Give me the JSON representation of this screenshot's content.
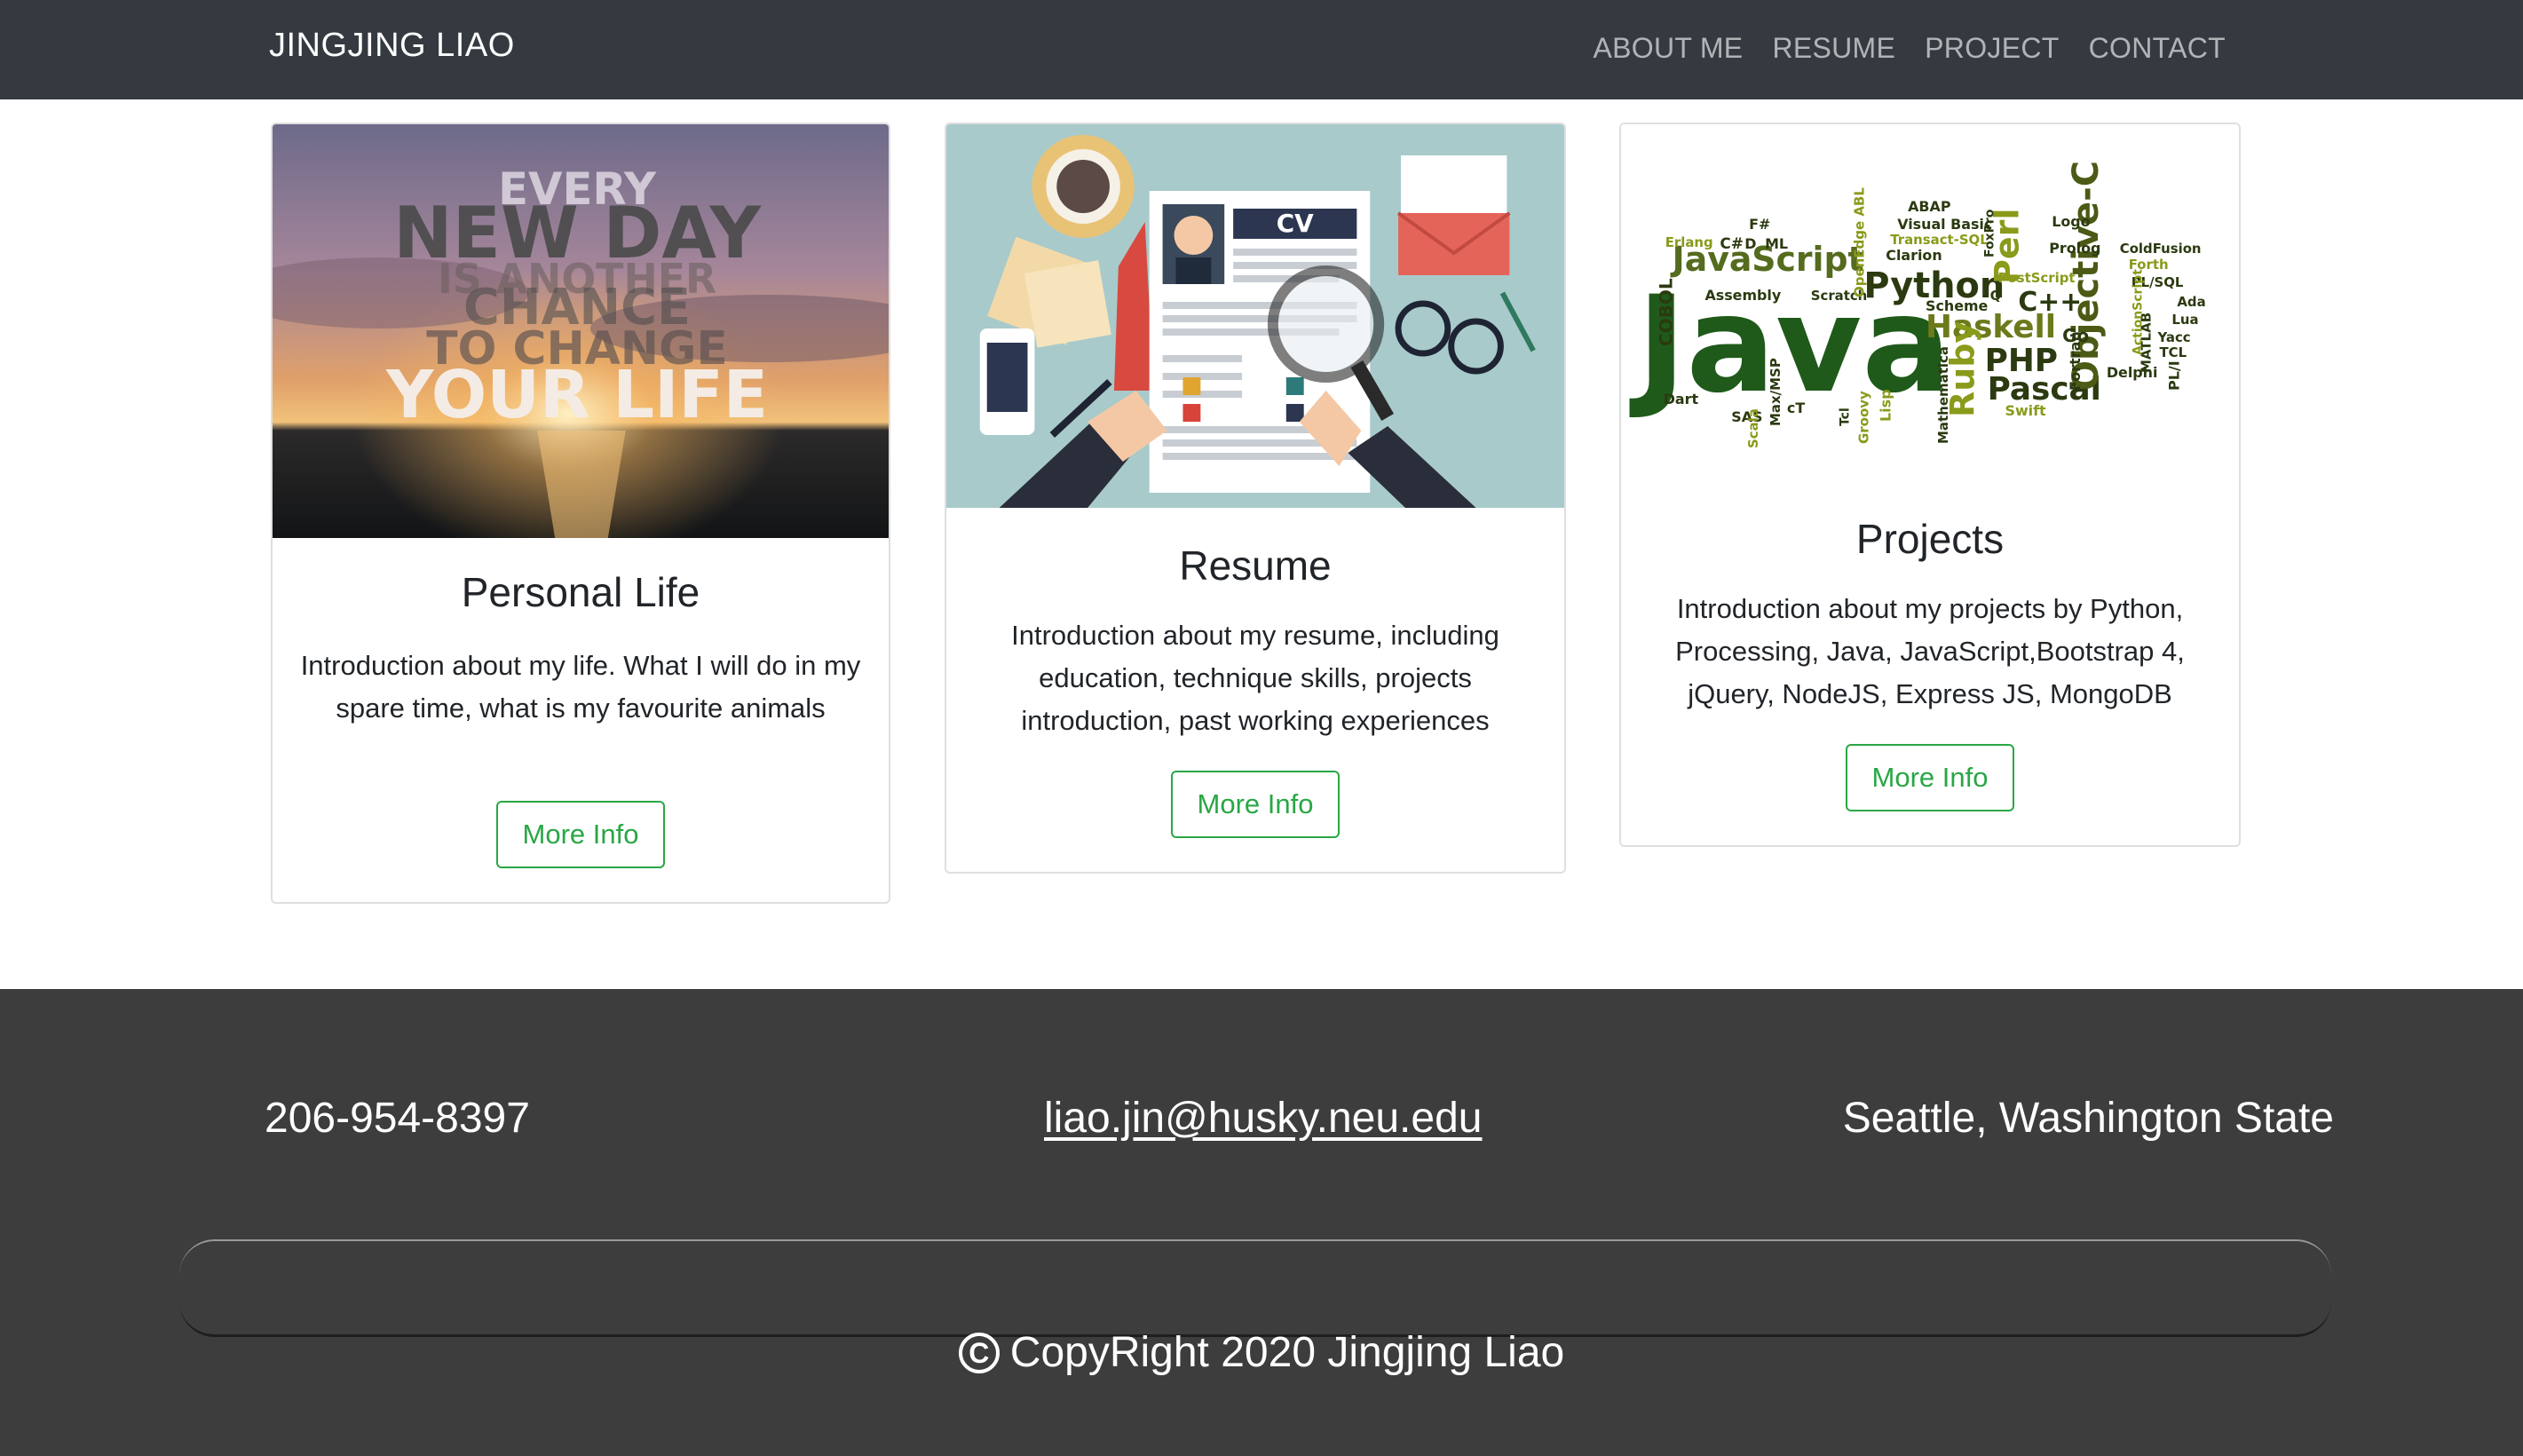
{
  "navbar": {
    "brand": "JINGJING LIAO",
    "links": [
      "ABOUT ME",
      "RESUME",
      "PROJECT",
      "CONTACT"
    ]
  },
  "cards": [
    {
      "image_icon": "sunset-quote-image",
      "image_text": [
        "EVERY",
        "NEW DAY",
        "IS ANOTHER",
        "CHANCE",
        "TO CHANGE",
        "YOUR LIFE"
      ],
      "title": "Personal Life",
      "text": "Introduction about my life. What I will do in my spare time, what is my favourite animals",
      "button": "More Info"
    },
    {
      "image_icon": "resume-cv-illustration",
      "image_text": [
        "CV"
      ],
      "title": "Resume",
      "text": "Introduction about my resume, including education, technique skills, projects introduction, past working experiences",
      "button": "More Info"
    },
    {
      "image_icon": "programming-word-cloud",
      "image_text": [
        "Java",
        "JavaScript",
        "Python",
        "Haskell",
        "PHP",
        "Pascal",
        "Ruby",
        "Perl",
        "Objective-C",
        "C++",
        "C#",
        "F#",
        "Erlang",
        "COBOL",
        "ABAP",
        "Visual Basic",
        "Transact-SQL",
        "Prolog",
        "Logo",
        "ColdFusion",
        "Forth",
        "PL/SQL",
        "Lua",
        "Ada",
        "Yacc",
        "TCL",
        "PL/I",
        "Delphi",
        "Fortran",
        "MATLAB",
        "Scheme",
        "Go",
        "Lisp",
        "Swift",
        "SAS",
        "Dart",
        "Scala",
        "Groovy",
        "Mathematica",
        "Assembly",
        "Scratch",
        "Clarion",
        "PostScript",
        "ActionScript",
        "FoxPro",
        "ML",
        "D",
        "Max/MSP",
        "cT",
        "Tcl",
        "OpenEdge ABL",
        "Q"
      ],
      "title": "Projects",
      "text": "Introduction about my projects by Python, Processing, Java, JavaScript,Bootstrap 4, jQuery, NodeJS, Express JS, MongoDB",
      "button": "More Info"
    }
  ],
  "footer": {
    "phone": "206-954-8397",
    "email": "liao.jin@husky.neu.edu",
    "location": "Seattle, Washington State",
    "copyright_symbol": "C",
    "copyright": "CopyRight 2020 Jingjing Liao"
  },
  "colors": {
    "navbar_bg": "#343a40",
    "footer_bg": "#3d3d3d",
    "button_accent": "#28a745"
  }
}
